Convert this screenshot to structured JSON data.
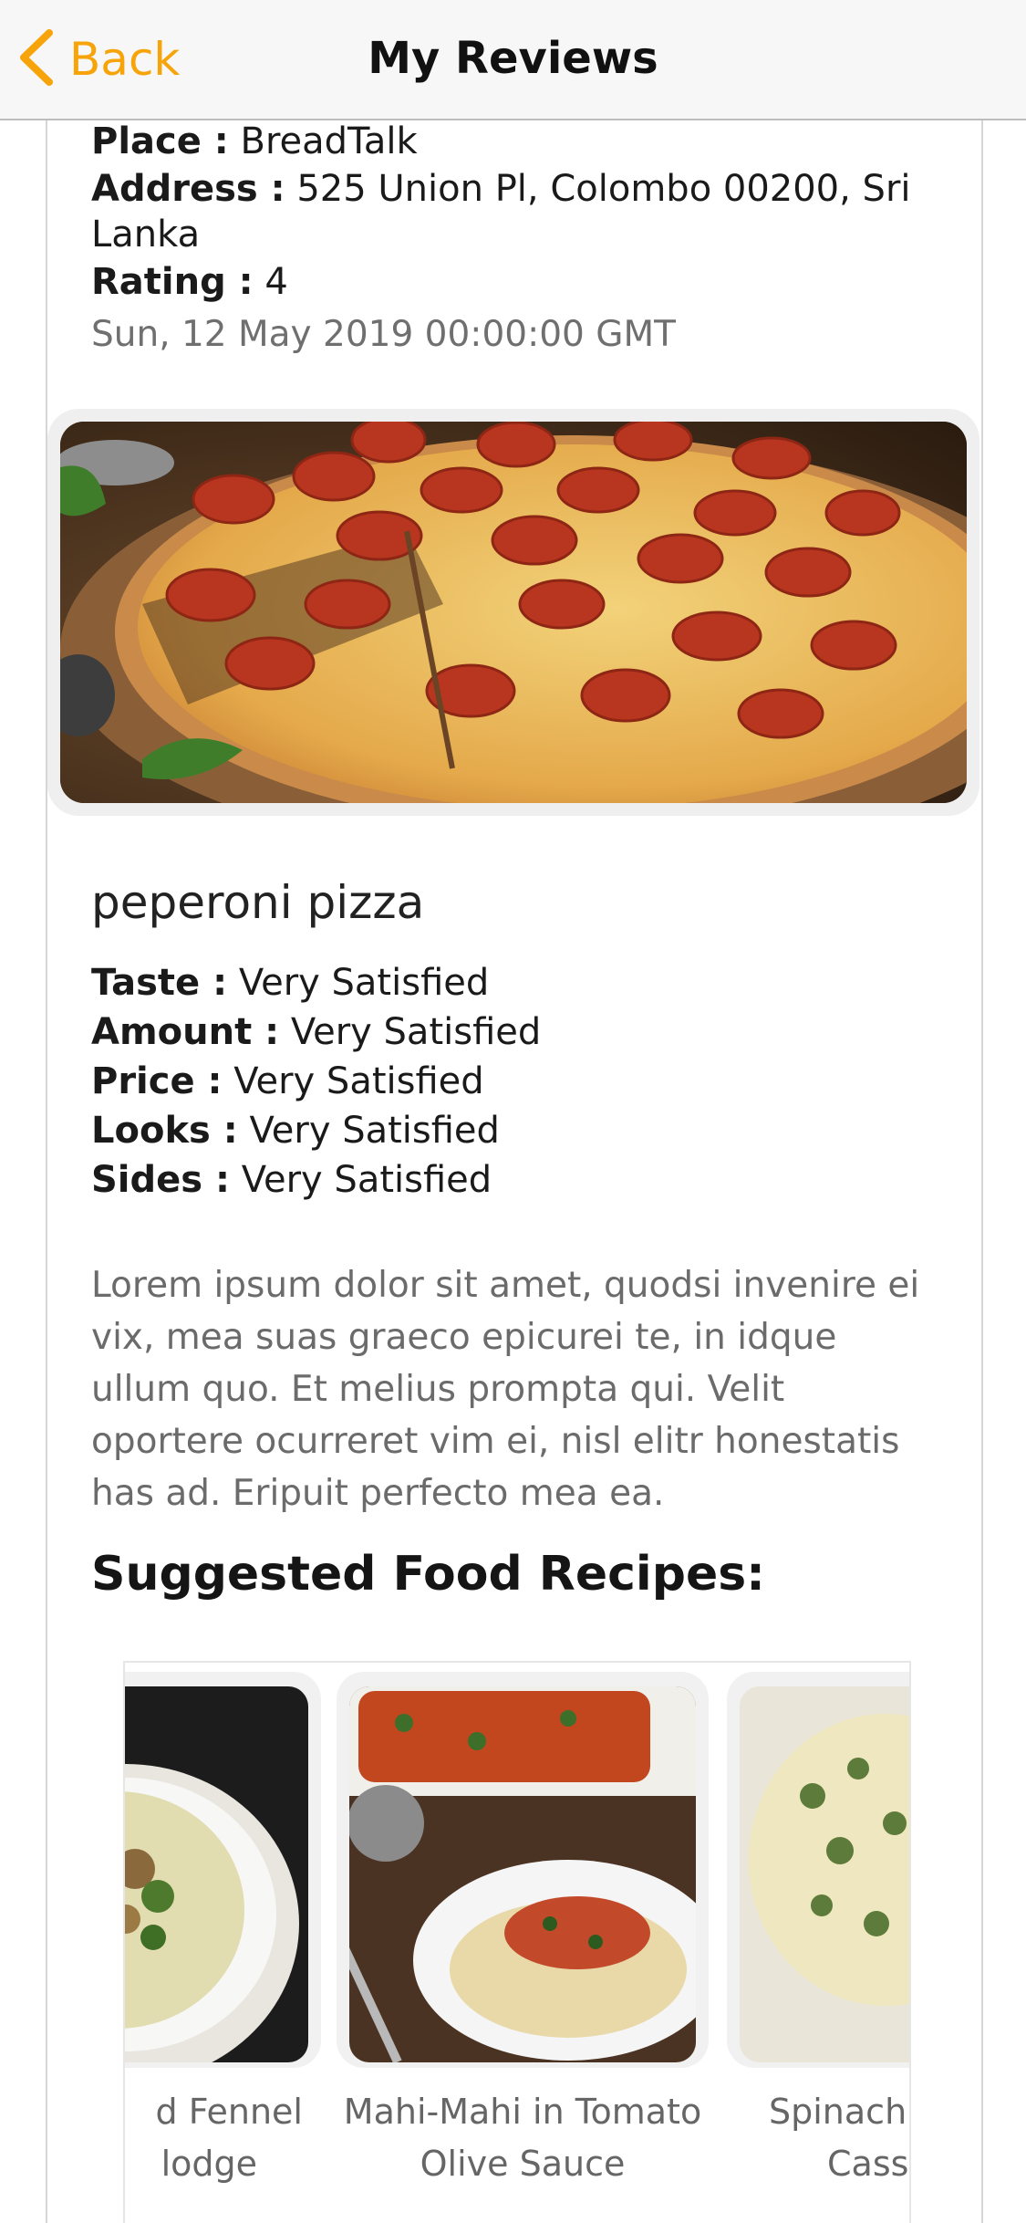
{
  "nav": {
    "back_label": "Back",
    "title": "My Reviews"
  },
  "review": {
    "place_label": "Place :",
    "place_value": "BreadTalk",
    "address_label": "Address :",
    "address_value": "525 Union Pl, Colombo 00200, Sri Lanka",
    "rating_label": "Rating :",
    "rating_value": "4",
    "date": "Sun, 12 May 2019 00:00:00 GMT",
    "dish_name": "peperoni pizza",
    "ratings": [
      {
        "label": "Taste :",
        "value": "Very Satisfied"
      },
      {
        "label": "Amount :",
        "value": "Very Satisfied"
      },
      {
        "label": "Price :",
        "value": "Very Satisfied"
      },
      {
        "label": "Looks :",
        "value": "Very Satisfied"
      },
      {
        "label": "Sides :",
        "value": "Very Satisfied"
      }
    ],
    "description": "Lorem ipsum dolor sit amet, quodsi invenire ei vix, mea suas graeco epicurei te, in idque ullum quo. Et melius prompta qui. Velit oportere ocurreret vim ei, nisl elitr honestatis has ad. Eripuit perfecto mea ea."
  },
  "suggested": {
    "title": "Suggested Food Recipes:",
    "recipes": [
      {
        "label_line1": "d Fennel",
        "label_line2": "lodge"
      },
      {
        "label_line1": "Mahi-Mahi in Tomato",
        "label_line2": "Olive Sauce"
      },
      {
        "label_line1": "Spinach",
        "label_line2": "Cass"
      }
    ]
  },
  "colors": {
    "accent": "#f7a30a",
    "navbar_bg": "#f7f7f7",
    "muted_text": "#6b6b6b"
  },
  "icons": {
    "back": "chevron-left-icon"
  }
}
